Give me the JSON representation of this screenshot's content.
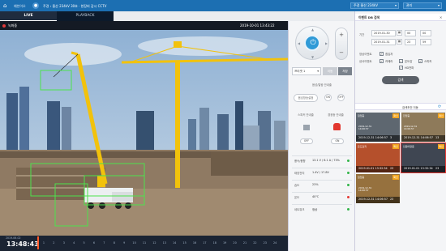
{
  "topbar": {
    "home_icon": "home-icon",
    "logo": "예천이오",
    "site_path": "주경 › 울산 234kV 30호 · 현장비 감시 CCTV",
    "site_select": "주경 울산 234kV",
    "user_select": "관리"
  },
  "tabs": [
    {
      "label": "LIVE"
    },
    {
      "label": "PLAYBACK"
    }
  ],
  "video": {
    "rec_label": "녹화중",
    "timestamp": "2019-10-01 13:43:22",
    "colors": {
      "sky": "#8eb4d9",
      "ground": "#8f7a63",
      "crane": "#f2c20c",
      "box": "#4ce34c"
    }
  },
  "timeline": {
    "date": "2019-06-02",
    "clock": "13:48:43",
    "ticks": [
      "1",
      "2",
      "3",
      "4",
      "5",
      "6",
      "7",
      "8",
      "9",
      "10",
      "11",
      "12",
      "13",
      "14",
      "15",
      "16",
      "17",
      "18",
      "19",
      "20",
      "21",
      "22",
      "23",
      "24"
    ]
  },
  "control": {
    "zoom_plus": "+",
    "zoom_minus": "−",
    "preset_select": "프리셋 1",
    "preset_btn1": "이동",
    "preset_btn2": "저장",
    "auto_title": "음성/알람 안내출",
    "auto_pill": "음성방송설정",
    "auto_on": "ON",
    "auto_off": "OFF",
    "speaker_label": "스피커 안내출",
    "siren_label": "경광등 안내출",
    "speaker_off": "OFF",
    "siren_on": "ON",
    "sensors": [
      {
        "label": "풍속/풍향",
        "value": "13.1 V / 6.1 A / 73%",
        "color": "#33b54a"
      },
      {
        "label": "태양전지",
        "value": "1.4V / 17.8V",
        "color": "#33b54a"
      },
      {
        "label": "습도",
        "value": "23%",
        "color": "#33b54a"
      },
      {
        "label": "온도",
        "value": "40℃",
        "color": "#e53935"
      },
      {
        "label": "네트워크",
        "value": "정상",
        "color": "#33b54a"
      }
    ]
  },
  "search": {
    "header": "이벤트 DB 검색",
    "close": "✕",
    "period_label": "기간",
    "date_from": "2019-01-30",
    "date_to": "2019-01-31",
    "h_from": "00",
    "m_from": "00",
    "h_to": "23",
    "m_to": "59",
    "event_label": "영상이벤트",
    "event_options": [
      {
        "label": "침입자",
        "checked": true
      }
    ],
    "sensor_label": "센서이벤트",
    "sensor_options": [
      {
        "label": "카메라",
        "checked": true
      },
      {
        "label": "온도감",
        "checked": true
      },
      {
        "label": "스피커",
        "checked": true
      },
      {
        "label": "HD전파",
        "checked": true
      }
    ],
    "search_btn": "검색"
  },
  "results": {
    "header": "검색조건 이동",
    "items": [
      {
        "title": "침입중",
        "badge": "확인",
        "meta": "2019-12-31\n14:06:57",
        "time": "2019-12-31 14:06:57",
        "count": "3",
        "bg": "#5e6770"
      },
      {
        "title": "진입중",
        "badge": "확인",
        "meta": "2019-12-31\n14:06:57",
        "time": "2019-12-31 14:06:57",
        "count": "13",
        "bg": "#8e7a5a"
      },
      {
        "title": "온도감지",
        "badge": "확인",
        "meta": "",
        "time": "2019.01.01 13:32:34",
        "count": "23",
        "bg": "#b5502c"
      },
      {
        "title": "인원이탈중",
        "badge": "확인",
        "meta": "",
        "time": "2019.01.01 13:32:34",
        "count": "23",
        "bg": "#3f4652",
        "selected": true
      },
      {
        "title": "침입중",
        "badge": "확인",
        "meta": "2019-12-31\n14:06:57",
        "time": "2019-12-31 14:06:57",
        "count": "23",
        "bg": "#96713e"
      }
    ]
  }
}
